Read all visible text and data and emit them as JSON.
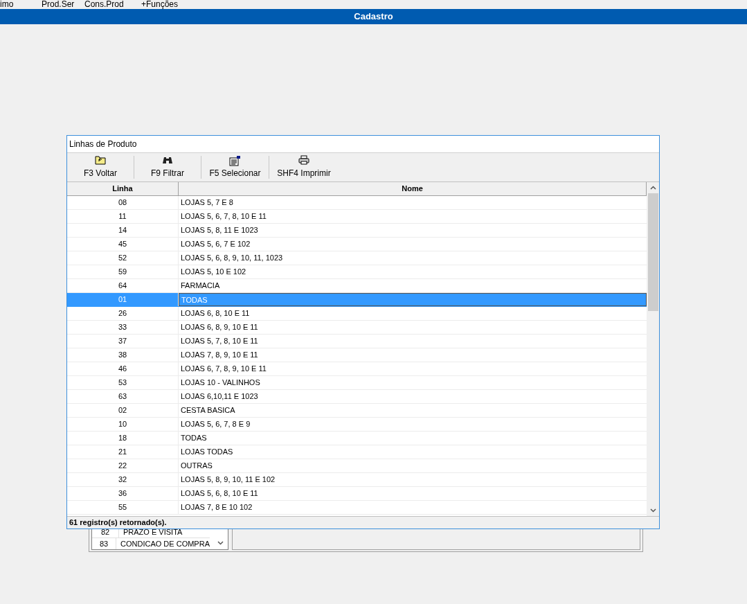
{
  "menu": [
    "imo",
    "Prod.Ser",
    "Cons.Prod",
    "+Funções"
  ],
  "title": "Cadastro",
  "background_list": {
    "rows": [
      {
        "code": "82",
        "name": "PRAZO E VISITA"
      },
      {
        "code": "83",
        "name": "CONDICAO DE COMPRA"
      }
    ]
  },
  "dialog": {
    "title": "Linhas de Produto",
    "toolbar": [
      {
        "kind": "back",
        "label": "F3 Voltar"
      },
      {
        "kind": "filter",
        "label": "F9 Filtrar"
      },
      {
        "kind": "select",
        "label": "F5 Selecionar"
      },
      {
        "kind": "print",
        "label": "SHF4 Imprimir"
      }
    ],
    "table": {
      "columns": [
        "Linha",
        "Nome"
      ],
      "rows": [
        {
          "linha": "08",
          "nome": "LOJAS 5, 7 E 8",
          "selected": false
        },
        {
          "linha": "11",
          "nome": "LOJAS 5, 6, 7, 8, 10 E 11",
          "selected": false
        },
        {
          "linha": "14",
          "nome": "LOJAS 5, 8, 11 E 1023",
          "selected": false
        },
        {
          "linha": "45",
          "nome": "LOJAS 5, 6, 7 E 102",
          "selected": false
        },
        {
          "linha": "52",
          "nome": "LOJAS 5, 6, 8, 9, 10, 11, 1023",
          "selected": false
        },
        {
          "linha": "59",
          "nome": "LOJAS 5, 10 E 102",
          "selected": false
        },
        {
          "linha": "64",
          "nome": "FARMACIA",
          "selected": false
        },
        {
          "linha": "01",
          "nome": "TODAS",
          "selected": true
        },
        {
          "linha": "26",
          "nome": "LOJAS 6, 8, 10 E 11",
          "selected": false
        },
        {
          "linha": "33",
          "nome": "LOJAS 6, 8, 9, 10 E 11",
          "selected": false
        },
        {
          "linha": "37",
          "nome": "LOJAS 5, 7, 8, 10 E 11",
          "selected": false
        },
        {
          "linha": "38",
          "nome": "LOJAS 7, 8, 9, 10 E 11",
          "selected": false
        },
        {
          "linha": "46",
          "nome": "LOJAS 6, 7, 8, 9, 10 E 11",
          "selected": false
        },
        {
          "linha": "53",
          "nome": "LOJAS 10 - VALINHOS",
          "selected": false
        },
        {
          "linha": "63",
          "nome": "LOJAS 6,10,11 E 1023",
          "selected": false
        },
        {
          "linha": "02",
          "nome": "CESTA BASICA",
          "selected": false
        },
        {
          "linha": "10",
          "nome": "LOJAS 5, 6, 7, 8 E 9",
          "selected": false
        },
        {
          "linha": "18",
          "nome": "TODAS",
          "selected": false
        },
        {
          "linha": "21",
          "nome": "LOJAS TODAS",
          "selected": false
        },
        {
          "linha": "22",
          "nome": "OUTRAS",
          "selected": false
        },
        {
          "linha": "32",
          "nome": "LOJAS 5, 8, 9, 10, 11 E 102",
          "selected": false
        },
        {
          "linha": "36",
          "nome": "LOJAS 5, 6, 8, 10 E 11",
          "selected": false
        },
        {
          "linha": "55",
          "nome": "LOJAS 7, 8 E 10 102",
          "selected": false
        }
      ]
    },
    "status": "61 registro(s) retornado(s)."
  }
}
